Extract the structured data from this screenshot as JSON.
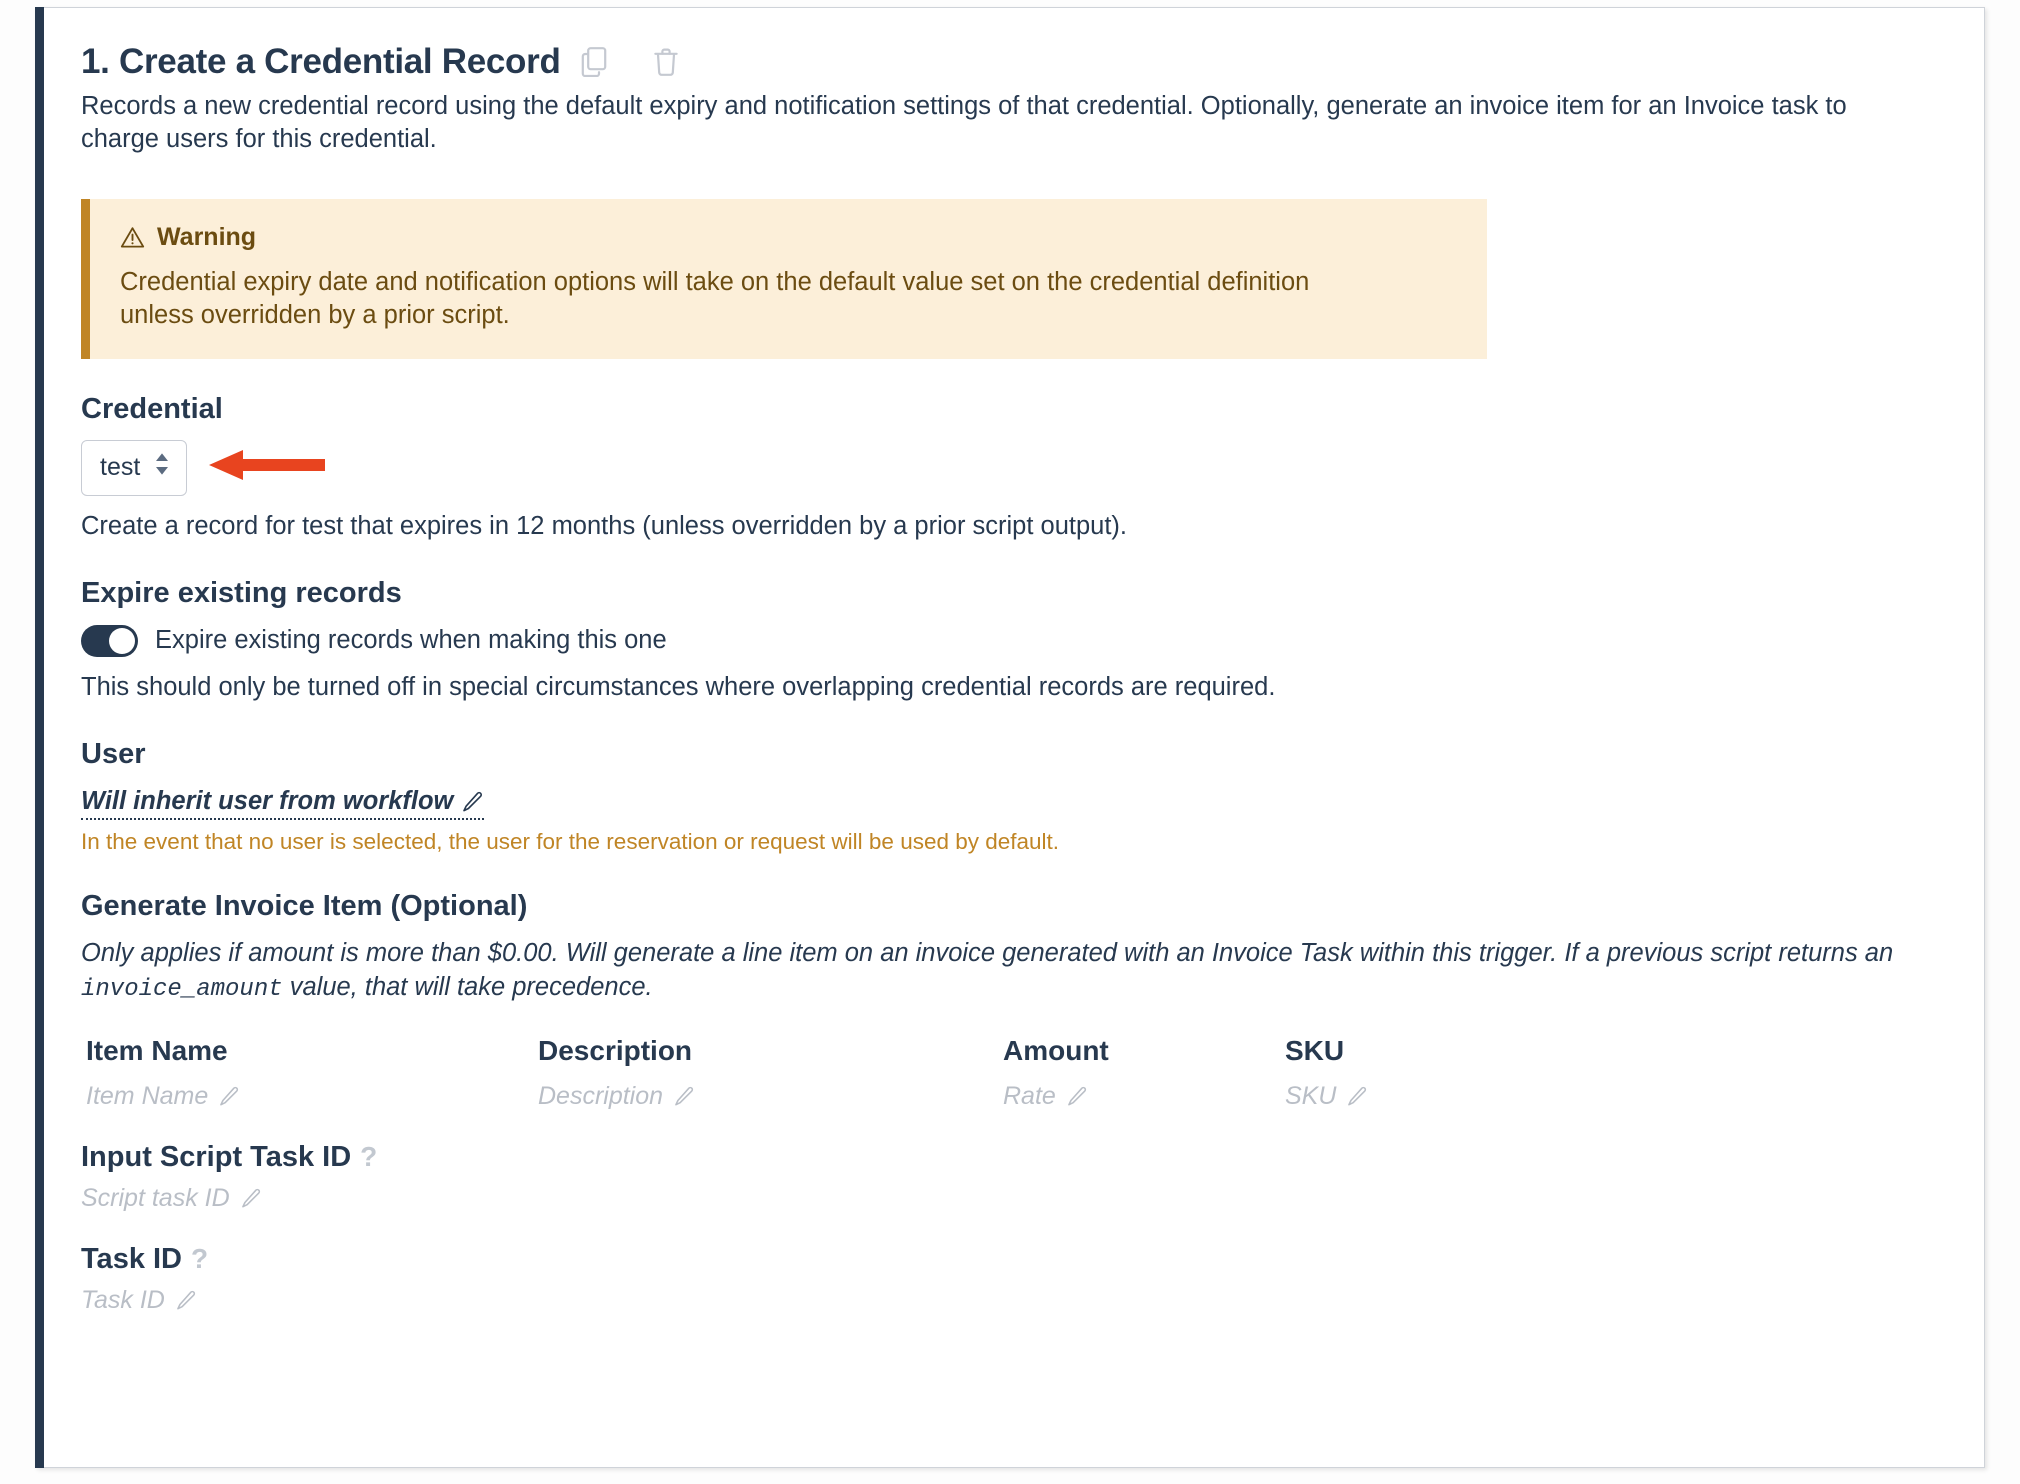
{
  "card": {
    "accent_color": "#27394f",
    "border_color": "#cfd3d9"
  },
  "header": {
    "title": "1. Create a Credential Record",
    "copy_icon": "copy-icon",
    "delete_icon": "trash-icon",
    "description": "Records a new credential record using the default expiry and notification settings of that credential. Optionally, generate an invoice item for an Invoice task to charge users for this credential."
  },
  "warning": {
    "icon": "warning-triangle-icon",
    "title": "Warning",
    "body": "Credential expiry date and notification options will take on the default value set on the credential definition unless overridden by a prior script.",
    "background": "#fcefd9",
    "accent": "#c08525",
    "text_color": "#6b4c11"
  },
  "credential": {
    "heading": "Credential",
    "selected_value": "test",
    "options": [
      "test"
    ],
    "helper_text": "Create a record for test that expires in 12 months (unless overridden by a prior script output).",
    "annotation_arrow_color": "#e8441f"
  },
  "expire": {
    "heading": "Expire existing records",
    "toggle_on": true,
    "toggle_label": "Expire existing records when making this one",
    "helper_text": "This should only be turned off in special circumstances where overlapping credential records are required."
  },
  "user": {
    "heading": "User",
    "value": "Will inherit user from workflow",
    "edit_icon": "pencil-icon",
    "note": "In the event that no user is selected, the user for the reservation or request will be used by default.",
    "note_color": "#c08525"
  },
  "invoice": {
    "heading": "Generate Invoice Item (Optional)",
    "note_prefix": "Only applies if amount is more than $0.00. Will generate a line item on an invoice generated with an Invoice Task within this trigger. If a previous script returns an ",
    "note_code": "invoice_amount",
    "note_suffix": " value, that will take precedence.",
    "columns": [
      {
        "header": "Item Name",
        "placeholder": "Item Name"
      },
      {
        "header": "Description",
        "placeholder": "Description"
      },
      {
        "header": "Amount",
        "placeholder": "Rate"
      },
      {
        "header": "SKU",
        "placeholder": "SKU"
      }
    ]
  },
  "input_script_task": {
    "heading": "Input Script Task ID",
    "help_icon": "?",
    "placeholder": "Script task ID"
  },
  "task_id": {
    "heading": "Task ID",
    "help_icon": "?",
    "placeholder": "Task ID"
  }
}
